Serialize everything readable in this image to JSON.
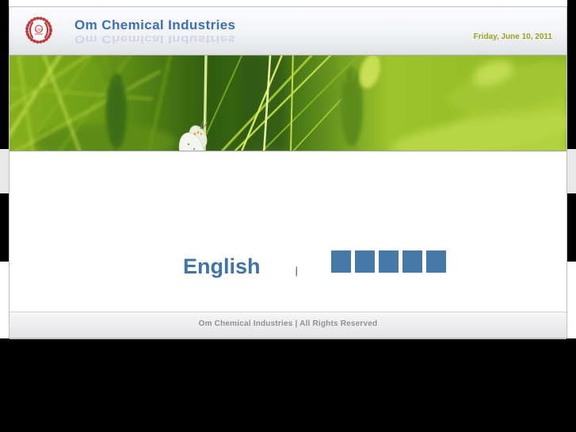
{
  "header": {
    "title": "Om Chemical Industries",
    "date": "Friday, June 10, 2011",
    "logo_icon": "red-circular-emblem"
  },
  "banner": {
    "description": "green-wheat-field-with-butterfly"
  },
  "language_bar": {
    "english_label": "English",
    "separator": "|",
    "block_count": 5
  },
  "footer": {
    "text": "Om Chemical Industries | All Rights Reserved"
  },
  "colors": {
    "title-blue": "#3a6fc0",
    "date-olive": "#9aa41f",
    "english-blue": "#3e74ad",
    "block-blue": "#4579a8",
    "footer-grey": "#8e9093",
    "grey-band": "#e8e8e8"
  }
}
